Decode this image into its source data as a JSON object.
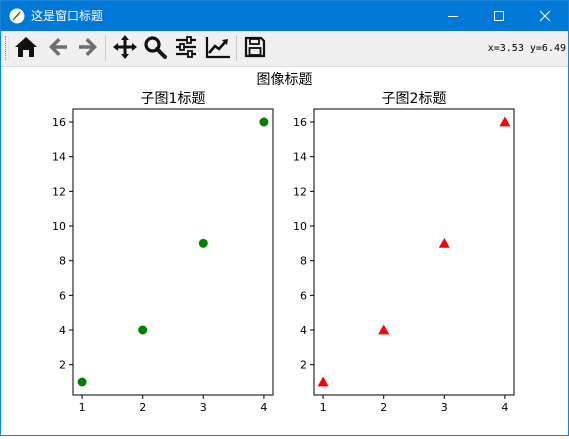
{
  "window": {
    "title": "这是窗口标题",
    "controls": {
      "minimize": "minimize",
      "maximize": "maximize",
      "close": "close"
    }
  },
  "toolbar": {
    "buttons": [
      {
        "name": "home-icon",
        "label": "Home"
      },
      {
        "name": "back-icon",
        "label": "Back"
      },
      {
        "name": "forward-icon",
        "label": "Forward"
      },
      {
        "name": "pan-icon",
        "label": "Pan"
      },
      {
        "name": "zoom-icon",
        "label": "Zoom"
      },
      {
        "name": "configure-subplots-icon",
        "label": "Subplots"
      },
      {
        "name": "edit-axis-icon",
        "label": "Customize"
      },
      {
        "name": "save-icon",
        "label": "Save"
      }
    ],
    "coordinates": "x=3.53 y=6.49"
  },
  "figure": {
    "title": "图像标题"
  },
  "chart_data": [
    {
      "type": "scatter",
      "title": "子图1标题",
      "xlabel": "",
      "ylabel": "",
      "x": [
        1,
        2,
        3,
        4
      ],
      "y": [
        1,
        4,
        9,
        16
      ],
      "xlim": [
        0.85,
        4.15
      ],
      "ylim": [
        0.25,
        16.75
      ],
      "xticks": [
        1,
        2,
        3,
        4
      ],
      "yticks": [
        2,
        4,
        6,
        8,
        10,
        12,
        14,
        16
      ],
      "marker": "circle",
      "color": "#008000",
      "grid": false
    },
    {
      "type": "scatter",
      "title": "子图2标题",
      "xlabel": "",
      "ylabel": "",
      "x": [
        1,
        2,
        3,
        4
      ],
      "y": [
        1,
        4,
        9,
        16
      ],
      "xlim": [
        0.85,
        4.15
      ],
      "ylim": [
        0.25,
        16.75
      ],
      "xticks": [
        1,
        2,
        3,
        4
      ],
      "yticks": [
        2,
        4,
        6,
        8,
        10,
        12,
        14,
        16
      ],
      "marker": "triangle",
      "color": "#ff0000",
      "grid": false
    }
  ]
}
